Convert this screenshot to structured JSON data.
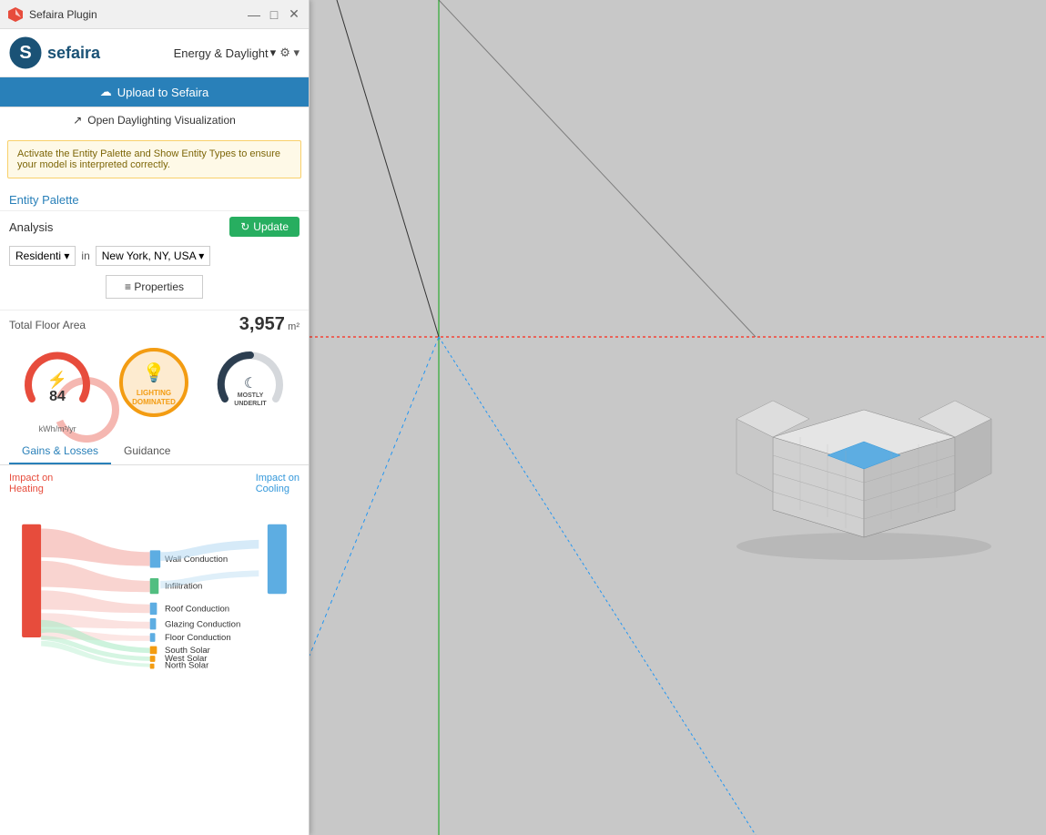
{
  "window": {
    "title": "Sefaira Plugin",
    "min_label": "—",
    "max_label": "□",
    "close_label": "✕"
  },
  "header": {
    "logo_text": "sefaira",
    "mode_label": "Energy & Daylight",
    "mode_arrow": "▾",
    "settings_icon": "⚙",
    "settings_arrow": "▾"
  },
  "buttons": {
    "upload_label": "Upload to Sefaira",
    "upload_icon": "☁",
    "daylight_label": "Open Daylighting Visualization",
    "daylight_icon": "↗"
  },
  "warning": {
    "text": "Activate the Entity Palette and Show Entity Types to ensure your model is interpreted correctly."
  },
  "entity_palette": {
    "label": "Entity Palette"
  },
  "analysis": {
    "label": "Analysis",
    "update_label": "Update",
    "update_icon": "↻"
  },
  "building_type": {
    "value": "Residenti",
    "arrow": "▾",
    "in_text": "in",
    "location": "New York, NY, USA",
    "location_arrow": "▾"
  },
  "properties": {
    "label": "≡ Properties"
  },
  "floor_area": {
    "label": "Total Floor Area",
    "value": "3,957",
    "unit": "m²"
  },
  "energy_gauge": {
    "value": "84",
    "unit": "kWh/m²/yr",
    "color": "#e74c3c",
    "bg_color": "#f5b7b1"
  },
  "lighting_gauge": {
    "label": "LIGHTING\nDOMINATED",
    "color": "#f39c12",
    "bg_color": "#fdebd0"
  },
  "daylight_gauge": {
    "label": "MOSTLY\nUNDERLIT",
    "color": "#2c3e50",
    "bg_color": "#d5d8dc"
  },
  "tabs": [
    {
      "id": "gains-losses",
      "label": "Gains & Losses",
      "active": true
    },
    {
      "id": "guidance",
      "label": "Guidance",
      "active": false
    }
  ],
  "impact": {
    "heating_label": "Impact on\nHeating",
    "cooling_label": "Impact on\nCooling"
  },
  "energy_flows": [
    {
      "label": "Wall Conduction",
      "color": "#5dade2"
    },
    {
      "label": "Infiltration",
      "color": "#52be80"
    },
    {
      "label": "Roof Conduction",
      "color": "#5dade2"
    },
    {
      "label": "Glazing Conduction",
      "color": "#5dade2"
    },
    {
      "label": "Floor Conduction",
      "color": "#5dade2"
    },
    {
      "label": "South Solar",
      "color": "#f39c12"
    },
    {
      "label": "West Solar",
      "color": "#f39c12"
    },
    {
      "label": "North Solar",
      "color": "#f39c12"
    }
  ]
}
